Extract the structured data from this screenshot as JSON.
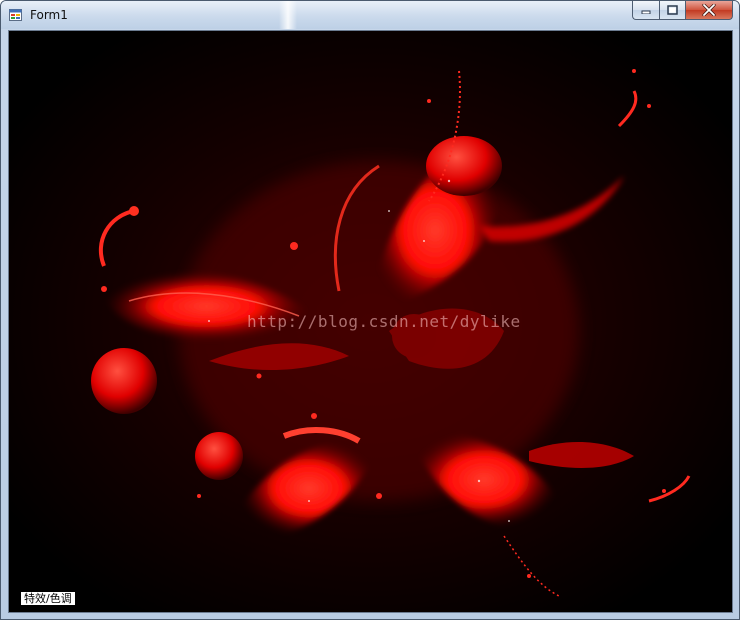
{
  "window": {
    "title": "Form1",
    "icon": "app-form-icon",
    "buttons": {
      "minimize": "minimize-icon",
      "maximize": "maximize-icon",
      "close": "close-icon"
    }
  },
  "image": {
    "description_icon": "red-abstract-flower-artwork",
    "watermark": "http://blog.csdn.net/dylike",
    "colors": {
      "background": "#000000",
      "accent": "#ff1010"
    }
  },
  "controls": {
    "effect_button_label": "特效/色调"
  }
}
